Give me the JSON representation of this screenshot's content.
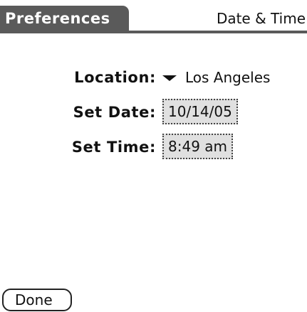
{
  "header": {
    "app_title": "Preferences",
    "section_name": "Date & Time"
  },
  "form": {
    "location": {
      "label": "Location:",
      "value": "Los Angeles",
      "icon": "triangle-down-icon"
    },
    "date": {
      "label": "Set Date:",
      "value": "10/14/05"
    },
    "time": {
      "label": "Set Time:",
      "value": "8:49 am"
    }
  },
  "footer": {
    "done_label": "Done"
  },
  "colors": {
    "title_bar": "#5a5a5a",
    "picker_background": "#e0e0e0",
    "text": "#111111",
    "background": "#ffffff"
  }
}
